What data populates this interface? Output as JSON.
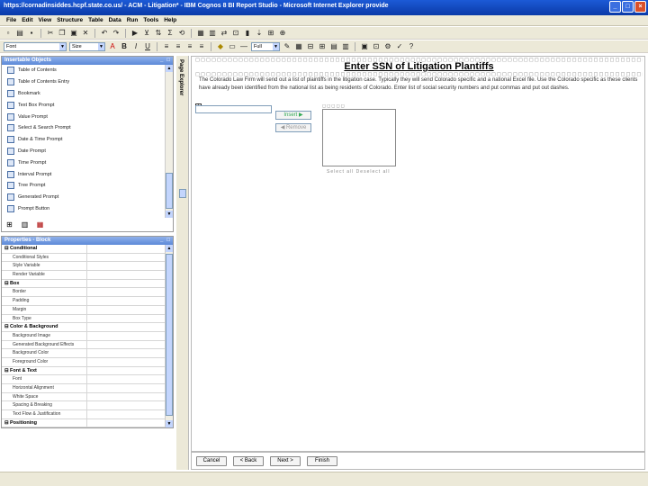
{
  "window": {
    "title": "https://cornadinsiddes.hcpf.state.co.us/ - ACM - Litigation* - IBM Cognos 8 BI Report Studio - Microsoft Internet Explorer provide",
    "controls": [
      "_",
      "□",
      "×"
    ]
  },
  "menubar": {
    "items": [
      "File",
      "Edit",
      "View",
      "Structure",
      "Table",
      "Data",
      "Run",
      "Tools",
      "Help"
    ]
  },
  "toolbar2": {
    "font_family": "Font",
    "font_size": "Size",
    "spacing": "Full"
  },
  "insertable_objects": {
    "title": "Insertable Objects",
    "items": [
      "Table of Contents",
      "Table of Contents Entry",
      "Bookmark",
      "Text Box Prompt",
      "Value Prompt",
      "Select & Search Prompt",
      "Date & Time Prompt",
      "Date Prompt",
      "Time Prompt",
      "Interval Prompt",
      "Tree Prompt",
      "Generated Prompt",
      "Prompt Button"
    ]
  },
  "properties": {
    "title": "Properties - Block",
    "rows": [
      {
        "name": "Conditional",
        "group": true,
        "toggle": "⊟"
      },
      {
        "name": "Conditional Styles",
        "group": false
      },
      {
        "name": "Style Variable",
        "group": false
      },
      {
        "name": "Render Variable",
        "group": false
      },
      {
        "name": "Box",
        "group": true,
        "toggle": "⊟"
      },
      {
        "name": "Border",
        "group": false
      },
      {
        "name": "Padding",
        "group": false
      },
      {
        "name": "Margin",
        "group": false
      },
      {
        "name": "Box Type",
        "group": false
      },
      {
        "name": "Color & Background",
        "group": true,
        "toggle": "⊟"
      },
      {
        "name": "Background Image",
        "group": false
      },
      {
        "name": "Generated Background Effects",
        "group": false
      },
      {
        "name": "Background Color",
        "group": false
      },
      {
        "name": "Foreground Color",
        "group": false
      },
      {
        "name": "Font & Text",
        "group": true,
        "toggle": "⊟"
      },
      {
        "name": "Font",
        "group": false
      },
      {
        "name": "Horizontal Alignment",
        "group": false
      },
      {
        "name": "White Space",
        "group": false
      },
      {
        "name": "Spacing & Breaking",
        "group": false
      },
      {
        "name": "Text Flow & Justification",
        "group": false
      },
      {
        "name": "Positioning",
        "group": true,
        "toggle": "⊟"
      }
    ]
  },
  "side_tab": {
    "label": "Page Explorer"
  },
  "canvas": {
    "heading": "Enter SSN of Litigation Plantiffs",
    "description": "The Colorado Law Firm will send out a list of plaintiffs in the litigation case. Typically they will send Colorado specific and a national Excel file. Use the Colorado specific as these clients have already been identified from the national list as being residents of Colorado. Enter list of social security numbers and put commas and put out dashes.",
    "add_label": "Insert ▶",
    "remove_label": "◀ Remove",
    "select_links": "Select all  Deselect all"
  },
  "prompt_buttons": {
    "cancel": "Cancel",
    "back": "< Back",
    "next": "Next >",
    "finish": "Finish"
  }
}
